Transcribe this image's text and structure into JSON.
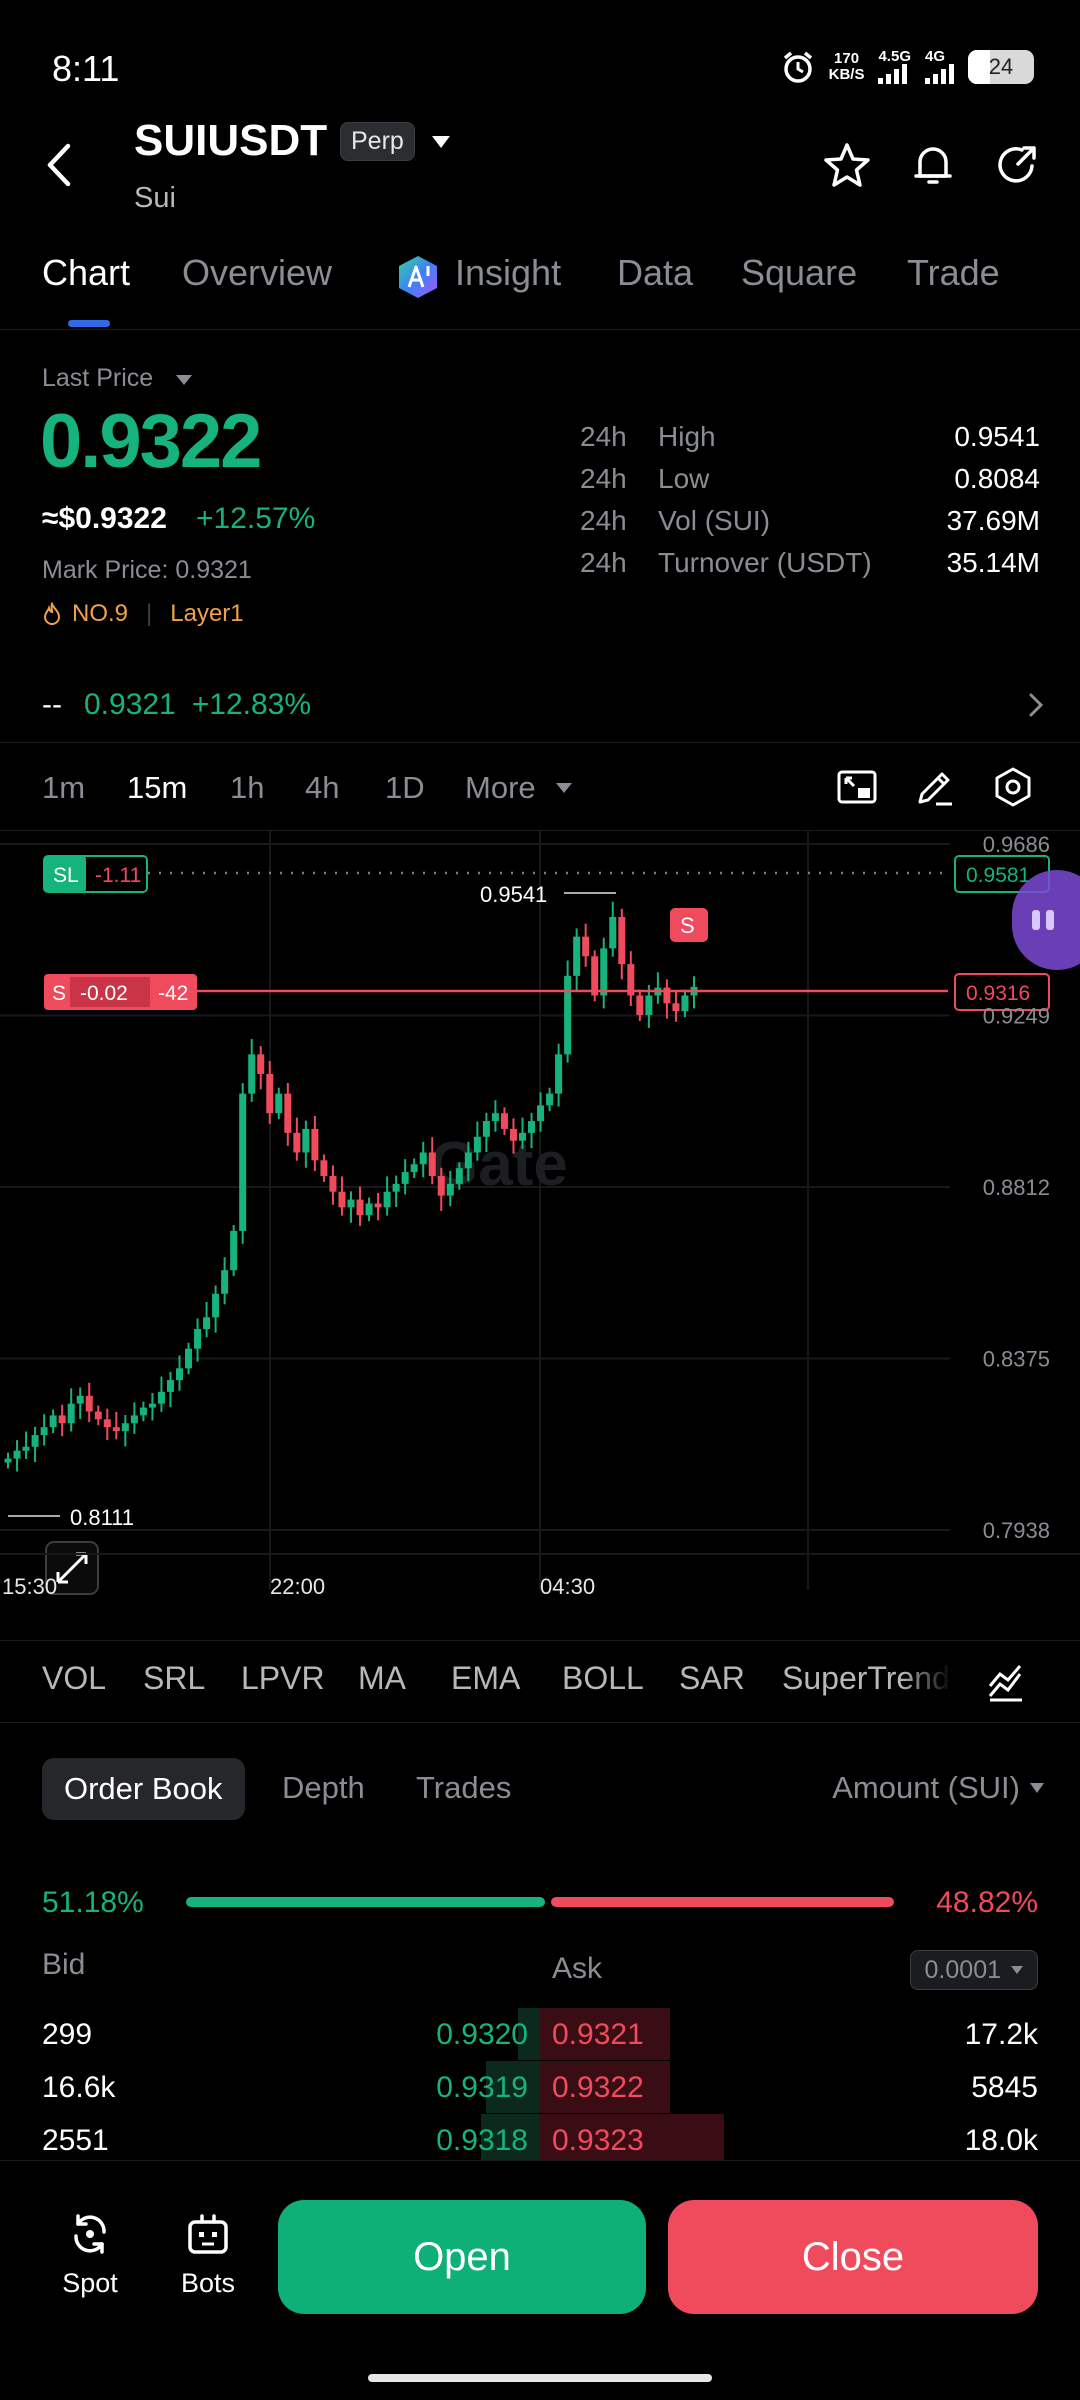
{
  "status": {
    "time": "8:11",
    "net_speed_value": "170",
    "net_speed_unit": "KB/S",
    "signal1": "4.5G",
    "signal2": "4G",
    "battery": "24"
  },
  "header": {
    "pair": "SUIUSDT",
    "contract_type": "Perp",
    "coin_name": "Sui"
  },
  "tabs": [
    "Chart",
    "Overview",
    "Insight",
    "Data",
    "Square",
    "Trade"
  ],
  "price": {
    "label": "Last Price",
    "last": "0.9322",
    "usd": "≈$0.9322",
    "change_pct": "+12.57%",
    "mark_price": "Mark Price: 0.9321",
    "rank": "NO.9",
    "sector": "Layer1"
  },
  "stats": [
    {
      "period": "24h",
      "label": "High",
      "value": "0.9541"
    },
    {
      "period": "24h",
      "label": "Low",
      "value": "0.8084"
    },
    {
      "period": "24h",
      "label": "Vol (SUI)",
      "value": "37.69M"
    },
    {
      "period": "24h",
      "label": "Turnover (USDT)",
      "value": "35.14M"
    }
  ],
  "index_row": {
    "left": "--",
    "price": "0.9321",
    "change": "+12.83%"
  },
  "timeframes": [
    "1m",
    "15m",
    "1h",
    "4h",
    "1D",
    "More"
  ],
  "chart_data": {
    "type": "candlestick",
    "y_ticks": [
      "0.9686",
      "0.9249",
      "0.8812",
      "0.8375",
      "0.7938"
    ],
    "ylim": [
      0.7938,
      0.9686
    ],
    "x_ticks": [
      "15:30",
      "22:00",
      "04:30"
    ],
    "high_label": "0.9541",
    "low_label": "0.8111",
    "sl_order": {
      "tag": "SL",
      "value": "-1.11",
      "price": "0.9581"
    },
    "position_line": {
      "tag": "S",
      "pnl": "-0.02",
      "qty": "-42",
      "price": "0.9316"
    },
    "marker": "S",
    "watermark": "Gate",
    "closes": [
      0.812,
      0.814,
      0.815,
      0.818,
      0.82,
      0.823,
      0.821,
      0.826,
      0.828,
      0.824,
      0.822,
      0.82,
      0.819,
      0.821,
      0.823,
      0.825,
      0.826,
      0.829,
      0.832,
      0.835,
      0.84,
      0.845,
      0.848,
      0.854,
      0.86,
      0.87,
      0.905,
      0.915,
      0.91,
      0.9,
      0.905,
      0.895,
      0.89,
      0.896,
      0.888,
      0.884,
      0.88,
      0.876,
      0.878,
      0.874,
      0.877,
      0.876,
      0.88,
      0.882,
      0.885,
      0.887,
      0.89,
      0.884,
      0.879,
      0.882,
      0.886,
      0.89,
      0.894,
      0.898,
      0.9,
      0.896,
      0.893,
      0.895,
      0.898,
      0.902,
      0.905,
      0.915,
      0.935,
      0.945,
      0.94,
      0.93,
      0.942,
      0.95,
      0.938,
      0.93,
      0.925,
      0.93,
      0.932,
      0.928,
      0.926,
      0.93,
      0.9322
    ]
  },
  "indicators": [
    "VOL",
    "SRL",
    "LPVR",
    "MA",
    "EMA",
    "BOLL",
    "SAR",
    "SuperTrend"
  ],
  "orderbook": {
    "tabs": [
      "Order Book",
      "Depth",
      "Trades"
    ],
    "amount_label": "Amount (SUI)",
    "bid_pct": "51.18%",
    "ask_pct": "48.82%",
    "bid_ratio": 0.5118,
    "bid_label": "Bid",
    "ask_label": "Ask",
    "precision": "0.0001",
    "rows": [
      {
        "bid_qty": "299",
        "bid_price": "0.9320",
        "ask_price": "0.9321",
        "ask_qty": "17.2k",
        "bid_depth": 0.04,
        "ask_depth": 0.24
      },
      {
        "bid_qty": "16.6k",
        "bid_price": "0.9319",
        "ask_price": "0.9322",
        "ask_qty": "5845",
        "bid_depth": 0.1,
        "ask_depth": 0.24
      },
      {
        "bid_qty": "2551",
        "bid_price": "0.9318",
        "ask_price": "0.9323",
        "ask_qty": "18.0k",
        "bid_depth": 0.11,
        "ask_depth": 0.34
      }
    ]
  },
  "bottom": {
    "spot": "Spot",
    "bots": "Bots",
    "open": "Open",
    "close": "Close"
  },
  "colors": {
    "up": "#16b37c",
    "down": "#f04a5d",
    "accent": "#2f6ae8"
  }
}
